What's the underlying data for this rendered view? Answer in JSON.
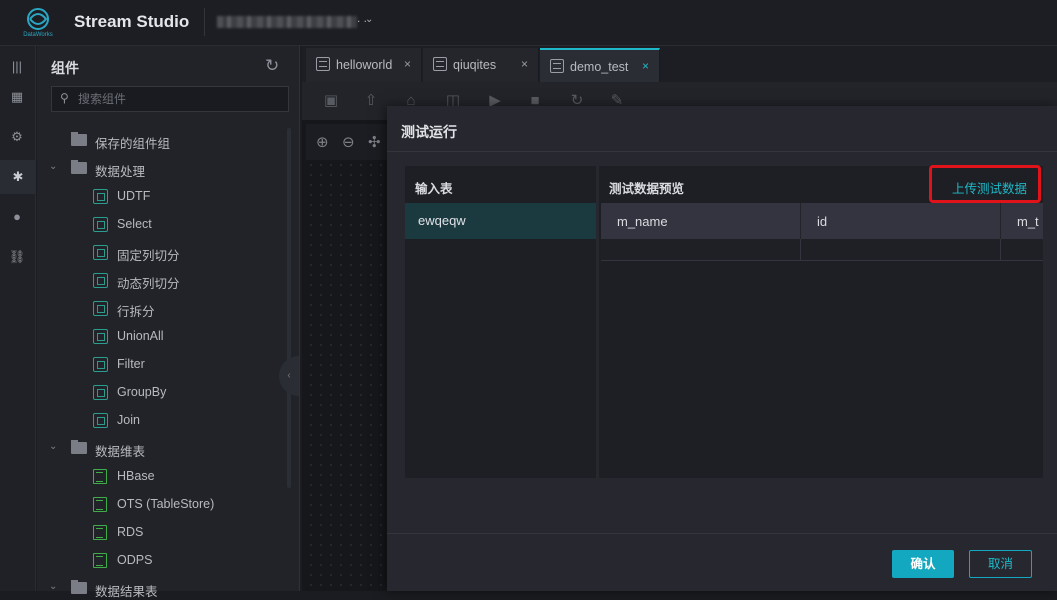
{
  "app": {
    "logo_subtext": "DataWorks",
    "title": "Stream Studio",
    "project_dots": ". .",
    "project_chevron": "⌄"
  },
  "sidebar_icons": [
    "list-icon",
    "calendar-icon",
    "settings-icon",
    "puzzle-icon",
    "chat-icon",
    "link-icon"
  ],
  "panel": {
    "title": "组件",
    "search_placeholder": "搜索组件",
    "tree": [
      {
        "label": "保存的组件组",
        "kind": "folder",
        "level": 0
      },
      {
        "label": "数据处理",
        "kind": "folder",
        "level": 0,
        "expanded": true
      },
      {
        "label": "UDTF",
        "kind": "component",
        "level": 1
      },
      {
        "label": "Select",
        "kind": "component",
        "level": 1
      },
      {
        "label": "固定列切分",
        "kind": "component",
        "level": 1
      },
      {
        "label": "动态列切分",
        "kind": "component",
        "level": 1
      },
      {
        "label": "行拆分",
        "kind": "component",
        "level": 1
      },
      {
        "label": "UnionAll",
        "kind": "component",
        "level": 1
      },
      {
        "label": "Filter",
        "kind": "component",
        "level": 1
      },
      {
        "label": "GroupBy",
        "kind": "component",
        "level": 1
      },
      {
        "label": "Join",
        "kind": "component",
        "level": 1
      },
      {
        "label": "数据维表",
        "kind": "folder",
        "level": 0,
        "expanded": true
      },
      {
        "label": "HBase",
        "kind": "table",
        "level": 1
      },
      {
        "label": "OTS (TableStore)",
        "kind": "table",
        "level": 1
      },
      {
        "label": "RDS",
        "kind": "table",
        "level": 1
      },
      {
        "label": "ODPS",
        "kind": "table",
        "level": 1
      },
      {
        "label": "数据结果表",
        "kind": "folder",
        "level": 0,
        "expanded": true
      }
    ]
  },
  "tabs": [
    {
      "label": "helloworld",
      "close": "×"
    },
    {
      "label": "qiuqites",
      "close": "×"
    },
    {
      "label": "demo_test",
      "close": "×",
      "active": true
    }
  ],
  "modal": {
    "title": "测试运行",
    "input_table_header": "输入表",
    "input_tables": [
      "ewqeqw"
    ],
    "preview_title": "测试数据预览",
    "upload_label": "上传测试数据",
    "columns": [
      "m_name",
      "id",
      "m_t"
    ],
    "confirm_label": "确认",
    "cancel_label": "取消"
  },
  "colors": {
    "accent": "#13a8c0",
    "highlight_box": "#e0121a",
    "selected_row": "#1b3a40"
  }
}
